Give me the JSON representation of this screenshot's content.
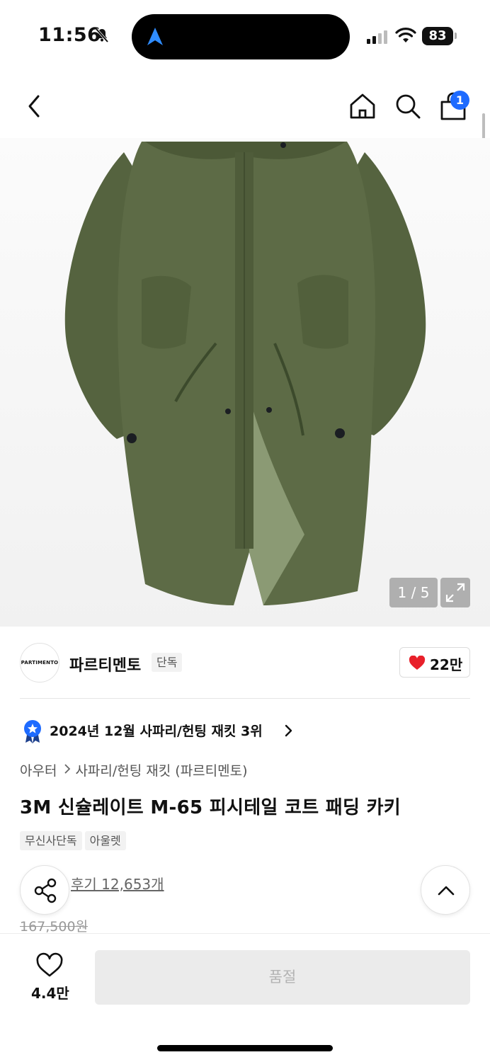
{
  "status_bar": {
    "time": "11:56",
    "battery": "83"
  },
  "nav": {
    "cart_count": "1"
  },
  "gallery": {
    "counter": "1 / 5"
  },
  "brand": {
    "logo_text": "PARTIMENTO",
    "name": "파르티멘토",
    "tag": "단독",
    "likes": "22만"
  },
  "ranking": {
    "text": "2024년 12월 사파리/헌팅 재킷 3위"
  },
  "breadcrumb": {
    "category": "아우터",
    "subcategory": "사파리/헌팅 재킷 (파르티멘토)"
  },
  "product": {
    "title": "3M 신슐레이트 M-65 피시테일 코트 패딩 카키",
    "tags": [
      "무신사단독",
      "아울렛"
    ],
    "reviews": "후기 12,653개",
    "original_price": "167,500원"
  },
  "bottom_bar": {
    "wish_count": "4.4만",
    "soldout_label": "품절"
  },
  "colors": {
    "accent": "#1e6bff",
    "heart": "#e8202a",
    "coat": "#5b6a45"
  }
}
